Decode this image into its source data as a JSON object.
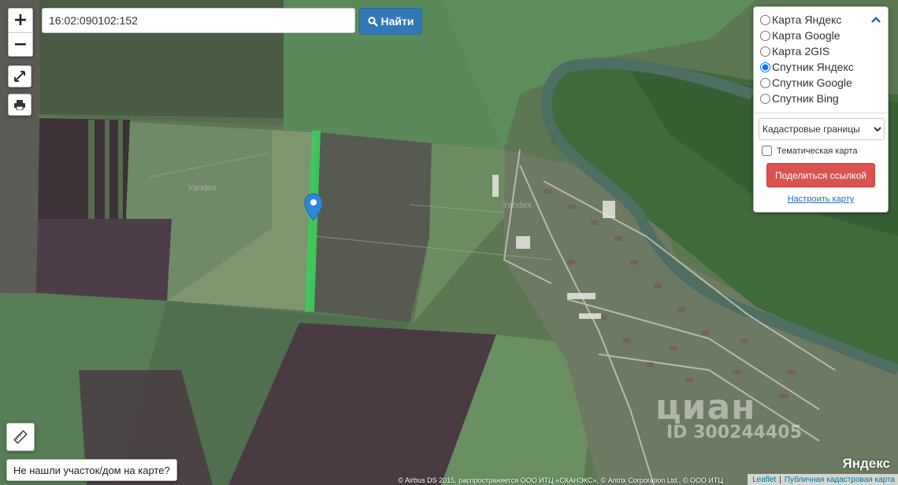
{
  "search": {
    "value": "16:02:090102:152",
    "button_label": "Найти"
  },
  "zoom": {
    "in_label": "+",
    "out_label": "−"
  },
  "layers": {
    "options": [
      {
        "label": "Карта Яндекс",
        "selected": false
      },
      {
        "label": "Карта Google",
        "selected": false
      },
      {
        "label": "Карта 2GIS",
        "selected": false
      },
      {
        "label": "Спутник Яндекс",
        "selected": true
      },
      {
        "label": "Спутник Google",
        "selected": false
      },
      {
        "label": "Спутник Bing",
        "selected": false
      }
    ],
    "overlay_select": "Кадастровые границы",
    "thematic_label": "Тематическая карта",
    "share_label": "Поделиться ссылкой",
    "settings_label": "Настроить карту"
  },
  "not_found_label": "Не нашли участок/дом на карте?",
  "attribution": {
    "copyright": "© Airbus DS 2015, распространяется ООО ИТЦ «СКАНЭКС», © Antrix Corporation Ltd., © ООО ИТЦ",
    "leaflet": "Leaflet",
    "separator": "|",
    "registry": "Публичная кадастровая карта"
  },
  "watermarks": {
    "yandex_logo": "Яндекс",
    "yandex_tile": "Yandex",
    "cian": "циан",
    "cian_id": "ID 300244405"
  },
  "colors": {
    "parcel_highlight": "#3fcb5c",
    "marker": "#2f86d6",
    "search_button": "#3278b8",
    "share_button": "#d9534f"
  }
}
